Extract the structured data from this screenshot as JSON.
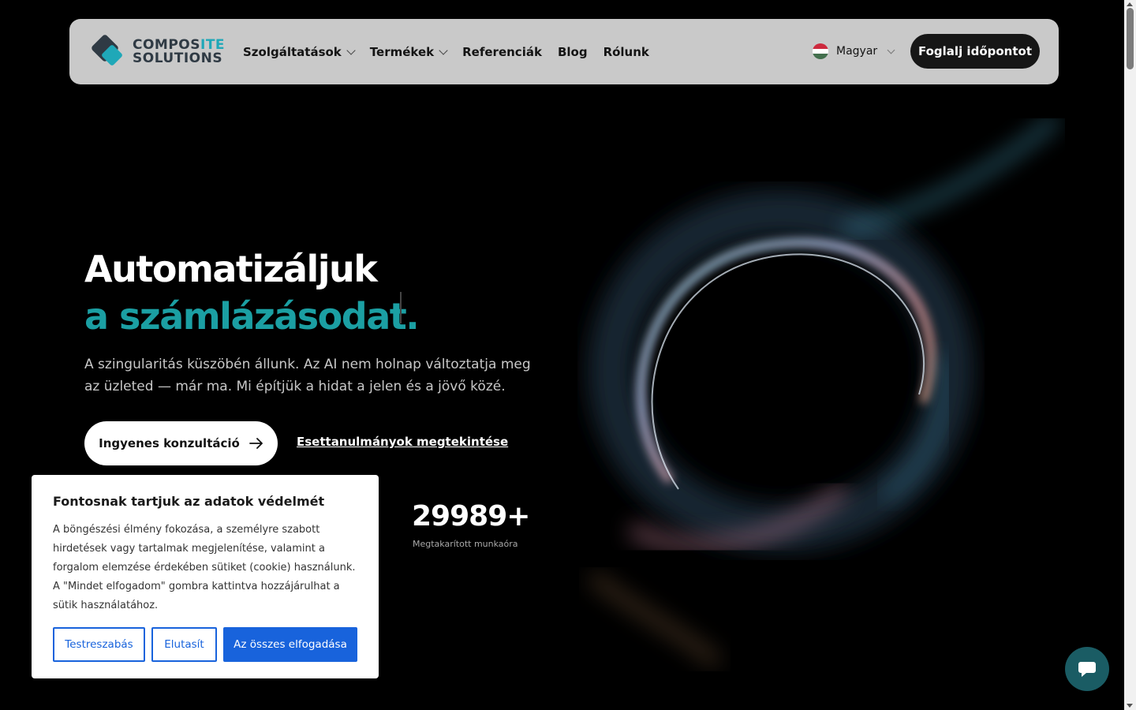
{
  "header": {
    "logo_line1a": "COMPOS",
    "logo_line1b": "ITE",
    "logo_line2": "SOLUTIONS",
    "nav": [
      {
        "label": "Szolgáltatások",
        "has_dropdown": true
      },
      {
        "label": "Termékek",
        "has_dropdown": true
      },
      {
        "label": "Referenciák",
        "has_dropdown": false
      },
      {
        "label": "Blog",
        "has_dropdown": false
      },
      {
        "label": "Rólunk",
        "has_dropdown": false
      }
    ],
    "language": "Magyar",
    "cta": "Foglalj időpontot"
  },
  "hero": {
    "title_line1": "Automatizáljuk",
    "title_line2": "a számlázásodat.",
    "subtitle": "A szingularitás küszöbén állunk. Az AI nem holnap változtatja meg az üzleted — már ma. Mi építjük a hidat a jelen és a jövő közé.",
    "primary_button": "Ingyenes konzultáció",
    "secondary_link": "Esettanulmányok megtekintése",
    "stat_value": "29989+",
    "stat_label": "Megtakarított munkaóra"
  },
  "cookie": {
    "title": "Fontosnak tartjuk az adatok védelmét",
    "body": "A böngészési élmény fokozása, a személyre szabott hirdetések vagy tartalmak megjelenítése, valamint a forgalom elemzése érdekében sütiket (cookie) használunk. A \"Mindet elfogadom\" gombra kattintva hozzájárulhat a sütik használatához.",
    "customize": "Testreszabás",
    "reject": "Elutasít",
    "accept_all": "Az összes elfogadása"
  },
  "colors": {
    "accent_teal": "#1b9fa3",
    "cookie_blue": "#1863dc",
    "nav_bg": "#c9c9c9"
  },
  "icons": [
    "chevron-down-icon",
    "hungary-flag-icon",
    "arrow-right-icon",
    "chat-bubble-icon"
  ]
}
